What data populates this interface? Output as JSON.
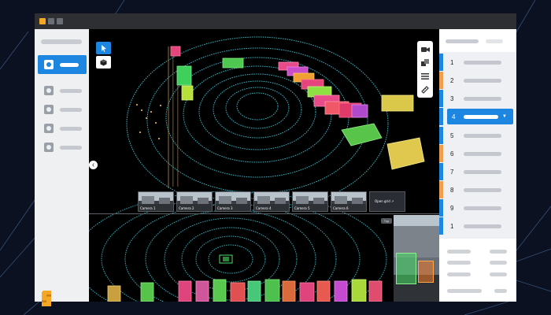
{
  "app": {
    "window_title": ""
  },
  "colors": {
    "accent": "#1c86e0",
    "logo": "#f5a623",
    "bar_blue": "#1c86e0",
    "bar_orange": "#f0a04c"
  },
  "sidebar": {
    "items": [
      {
        "icon": "camera-icon",
        "active": true
      },
      {
        "icon": "camera-icon",
        "active": false
      },
      {
        "icon": "camera-icon",
        "active": false
      },
      {
        "icon": "camera-icon",
        "active": false
      },
      {
        "icon": "camera-icon",
        "active": false
      }
    ]
  },
  "toolbar": {
    "tools": [
      "select-pointer-icon",
      "cube-icon"
    ],
    "right_tools": [
      "video-camera-icon",
      "layers-icon",
      "menu-icon",
      "measure-icon"
    ]
  },
  "viewer": {
    "thumbnails": [
      {
        "label": "Camera 1"
      },
      {
        "label": "Camera 2"
      },
      {
        "label": "Camera 3"
      },
      {
        "label": "Camera 4"
      },
      {
        "label": "Camera 5"
      },
      {
        "label": "Camera 6"
      },
      {
        "label": "Open grid ↗"
      }
    ],
    "top_badge": "Top"
  },
  "right_panel": {
    "list": [
      {
        "number": "1",
        "bar": "blue"
      },
      {
        "number": "2",
        "bar": "orange"
      },
      {
        "number": "3",
        "bar": "blue"
      },
      {
        "number": "4",
        "bar": "blue",
        "selected": true
      },
      {
        "number": "5",
        "bar": "blue"
      },
      {
        "number": "6",
        "bar": "orange"
      },
      {
        "number": "7",
        "bar": "blue"
      },
      {
        "number": "8",
        "bar": "orange"
      },
      {
        "number": "9",
        "bar": "blue"
      },
      {
        "number": "1",
        "bar": "blue"
      }
    ]
  }
}
